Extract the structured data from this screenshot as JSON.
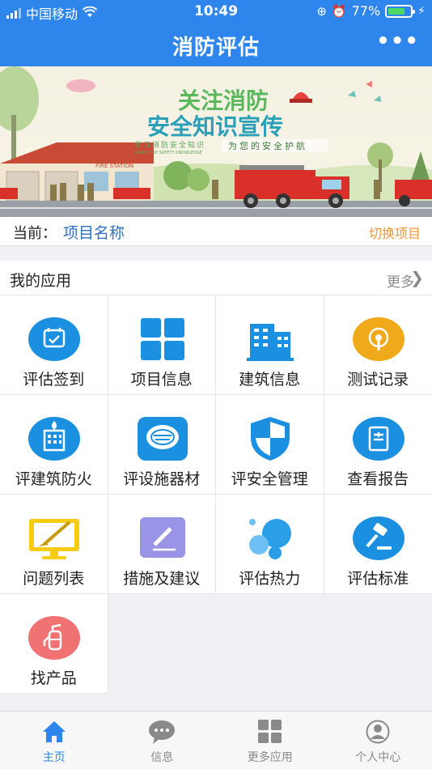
{
  "statusbar": {
    "carrier": "中国移动",
    "time": "10:49",
    "battery_percent": "77%",
    "battery_level": 0.77
  },
  "navbar": {
    "title": "消防评估",
    "more_label": "•••"
  },
  "banner": {
    "headline_line1": "关注消防",
    "headline_line2": "安全知识宣传",
    "subtitle": "学习消防安全知识",
    "subtitle_en": "LEARN FIRE SAFETY KNOWLEDGE",
    "slogan": "为您的安全护航",
    "station_sign": "FIRE STATION"
  },
  "project": {
    "label": "当前：",
    "name": "项目名称",
    "switch_label": "切换项目"
  },
  "apps": {
    "title": "我的应用",
    "more_label": "更多",
    "items": [
      {
        "label": "评估签到",
        "icon": "calendar-check-icon"
      },
      {
        "label": "项目信息",
        "icon": "grid-icon"
      },
      {
        "label": "建筑信息",
        "icon": "building-icon"
      },
      {
        "label": "测试记录",
        "icon": "record-icon"
      },
      {
        "label": "评建筑防火",
        "icon": "building-fire-icon"
      },
      {
        "label": "评设施器材",
        "icon": "smoke-detector-icon"
      },
      {
        "label": "评安全管理",
        "icon": "shield-icon"
      },
      {
        "label": "查看报告",
        "icon": "report-icon"
      },
      {
        "label": "问题列表",
        "icon": "monitor-brush-icon"
      },
      {
        "label": "措施及建议",
        "icon": "edit-icon"
      },
      {
        "label": "评估热力",
        "icon": "bubbles-icon"
      },
      {
        "label": "评估标准",
        "icon": "gavel-icon"
      },
      {
        "label": "找产品",
        "icon": "extinguisher-icon"
      }
    ]
  },
  "tabbar": {
    "items": [
      {
        "label": "主页",
        "icon": "home-icon",
        "active": true
      },
      {
        "label": "信息",
        "icon": "chat-icon",
        "active": false
      },
      {
        "label": "更多应用",
        "icon": "apps-icon",
        "active": false
      },
      {
        "label": "个人中心",
        "icon": "user-icon",
        "active": false
      }
    ]
  },
  "colors": {
    "primary": "#2e86ec",
    "accent_orange": "#f0962e",
    "project_name": "#2e6fc4"
  }
}
